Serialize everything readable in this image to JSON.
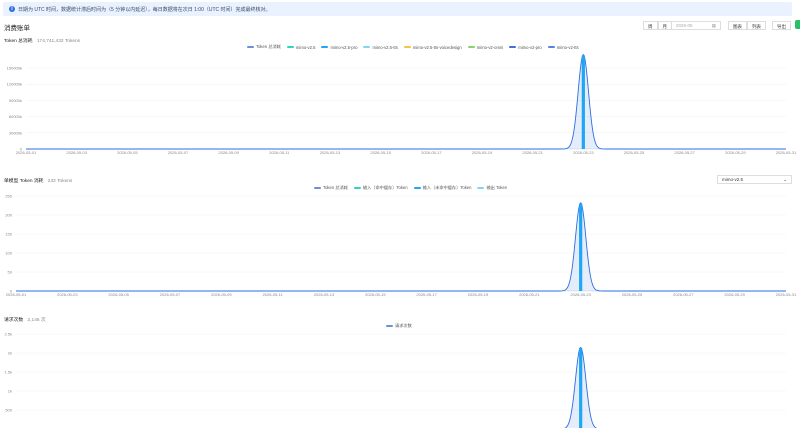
{
  "notice": {
    "icon": "info-icon",
    "text": "日期为 UTC 时间，数据统计滞后时间为（5 分钟以内延迟），每日数据将在次日 1:00（UTC 时间）完成最终核对。"
  },
  "page": {
    "title": "消费账单"
  },
  "toolbar": {
    "week_label": "周",
    "month_label": "月",
    "date_placeholder": "2026-05",
    "chart_view_label": "图表",
    "list_view_label": "列表",
    "export_label": "导出"
  },
  "token_section": {
    "title": "Token 总消耗",
    "total": "174,741,432 Tokens"
  },
  "model_section": {
    "title": "单模型 Token 消耗",
    "total": "232 Tokens",
    "selected_model": "mimo-v2.5"
  },
  "request_section": {
    "title": "请求次数",
    "total": "2,146 次"
  },
  "colors": {
    "primary": "#2b6de1",
    "accent": "#1fa6f5",
    "notice_bg": "#e9f2fe",
    "scroll_green": "#26c06c"
  },
  "chart_data": [
    {
      "type": "area",
      "yticks": [
        "0",
        "30000k",
        "60000k",
        "90000k",
        "120000k",
        "150000k"
      ],
      "ylim": [
        0,
        150000000
      ],
      "x": [
        "2026-05-01",
        "2026-05-03",
        "2026-05-05",
        "2026-05-07",
        "2026-05-09",
        "2026-05-11",
        "2026-05-13",
        "2026-05-15",
        "2026-05-17",
        "2026-05-19",
        "2026-05-21",
        "2026-05-23",
        "2026-05-25",
        "2026-05-27",
        "2026-05-29",
        "2026-05-31"
      ],
      "series_legend": [
        {
          "name": "Token 总消耗",
          "color": "#6b8fdd"
        },
        {
          "name": "mimo-v2.5",
          "color": "#2fd2c3"
        },
        {
          "name": "mimo-v2.5-pro",
          "color": "#1fa6f5"
        },
        {
          "name": "mimo-v2.5-tts",
          "color": "#7fd7f2"
        },
        {
          "name": "mimo-v2.5-tts-voicedesign",
          "color": "#f5c542"
        },
        {
          "name": "mimo-v2-omni",
          "color": "#8bd26a"
        },
        {
          "name": "mimo-v2-pro",
          "color": "#3d6fe0"
        },
        {
          "name": "mimo-v2-tts",
          "color": "#5a7fe6"
        }
      ],
      "peak_date": "2026-05-23",
      "peak_value": 174741432
    },
    {
      "type": "area",
      "yticks": [
        "0",
        "50",
        "100",
        "150",
        "200",
        "250"
      ],
      "ylim": [
        0,
        250
      ],
      "x": [
        "2026-05-01",
        "2026-05-03",
        "2026-05-05",
        "2026-05-07",
        "2026-05-09",
        "2026-05-11",
        "2026-05-13",
        "2026-05-15",
        "2026-05-17",
        "2026-05-19",
        "2026-05-21",
        "2026-05-23",
        "2026-05-25",
        "2026-05-27",
        "2026-05-29",
        "2026-05-31"
      ],
      "series_legend": [
        {
          "name": "Token 总消耗",
          "color": "#6b8fdd"
        },
        {
          "name": "输入（命中缓存）Token",
          "color": "#2fd2c3"
        },
        {
          "name": "输入（未命中缓存）Token",
          "color": "#1fa6f5"
        },
        {
          "name": "输出 Token",
          "color": "#7fd7f2"
        }
      ],
      "peak_date": "2026-05-23",
      "peak_value": 232
    },
    {
      "type": "area",
      "yticks": [
        "0",
        "500",
        "1k",
        "1.5k",
        "2k",
        "2.5k"
      ],
      "ylim": [
        0,
        2500
      ],
      "series_legend": [
        {
          "name": "请求次数",
          "color": "#6b8fdd"
        }
      ],
      "peak_date": "2026-05-23",
      "peak_value": 2146
    }
  ]
}
